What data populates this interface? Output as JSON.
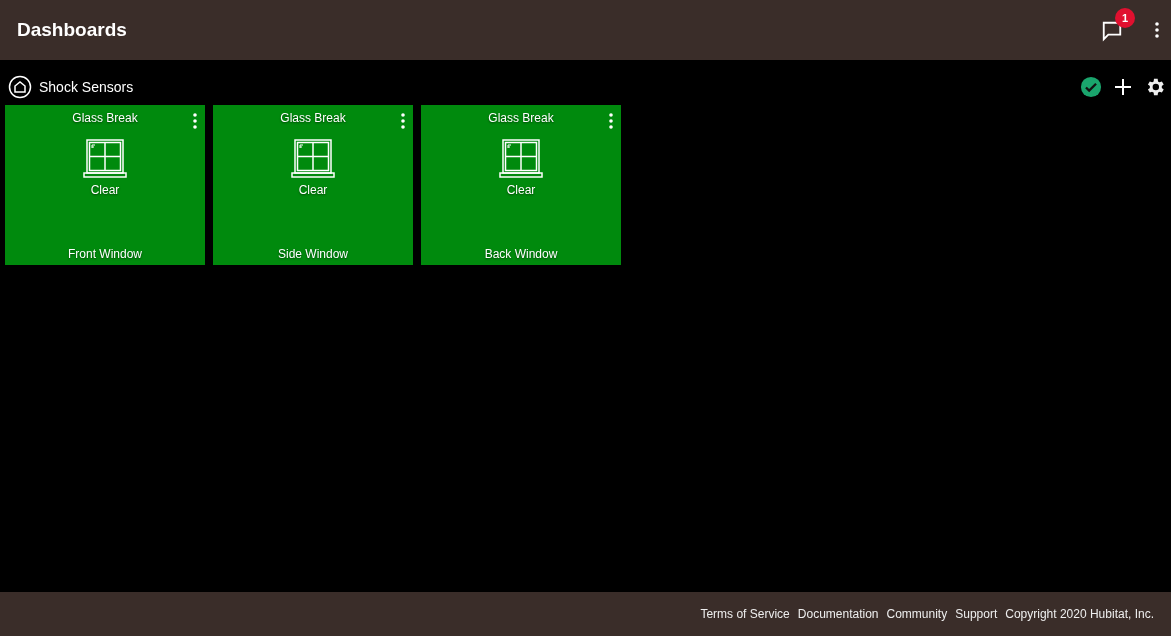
{
  "header": {
    "title": "Dashboards",
    "notification_count": "1"
  },
  "dashboard": {
    "name": "Shock Sensors"
  },
  "tiles": [
    {
      "title": "Glass Break",
      "status": "Clear",
      "name": "Front Window"
    },
    {
      "title": "Glass Break",
      "status": "Clear",
      "name": "Side Window"
    },
    {
      "title": "Glass Break",
      "status": "Clear",
      "name": "Back Window"
    }
  ],
  "footer": {
    "links": [
      "Terms of Service",
      "Documentation",
      "Community",
      "Support"
    ],
    "copyright": "Copyright 2020 Hubitat, Inc."
  }
}
